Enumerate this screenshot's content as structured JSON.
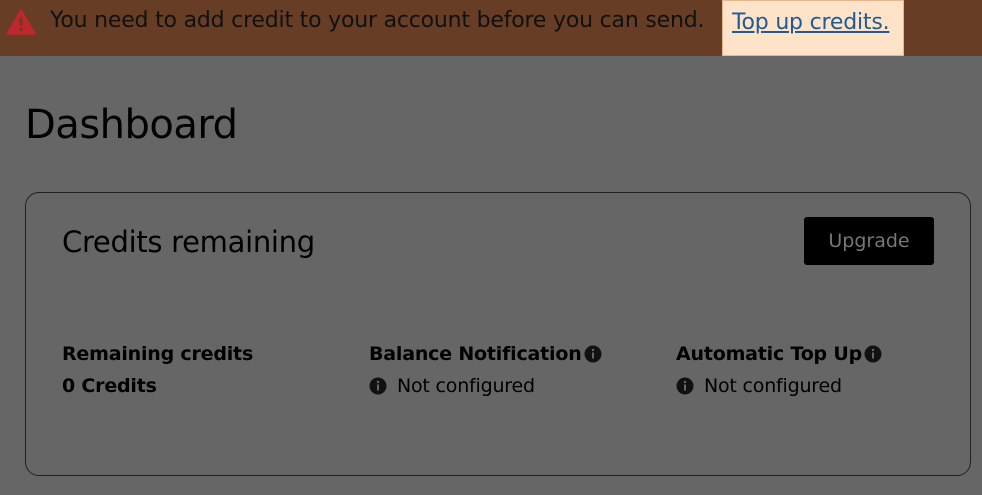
{
  "banner": {
    "icon": "warning-triangle-icon",
    "message": "You need to add credit to your account before you can send.",
    "link_label": "Top up credits.",
    "background_color": "#673e25",
    "icon_color": "#c0262d"
  },
  "page": {
    "title": "Dashboard"
  },
  "credits_card": {
    "title": "Credits remaining",
    "upgrade_label": "Upgrade",
    "stats": [
      {
        "label": "Remaining credits",
        "value": "0 Credits"
      },
      {
        "label": "Balance Notification",
        "value": "Not configured",
        "label_icon": "info-icon",
        "value_icon": "info-icon"
      },
      {
        "label": "Automatic Top Up",
        "value": "Not configured",
        "label_icon": "info-icon",
        "value_icon": "info-icon"
      }
    ]
  }
}
